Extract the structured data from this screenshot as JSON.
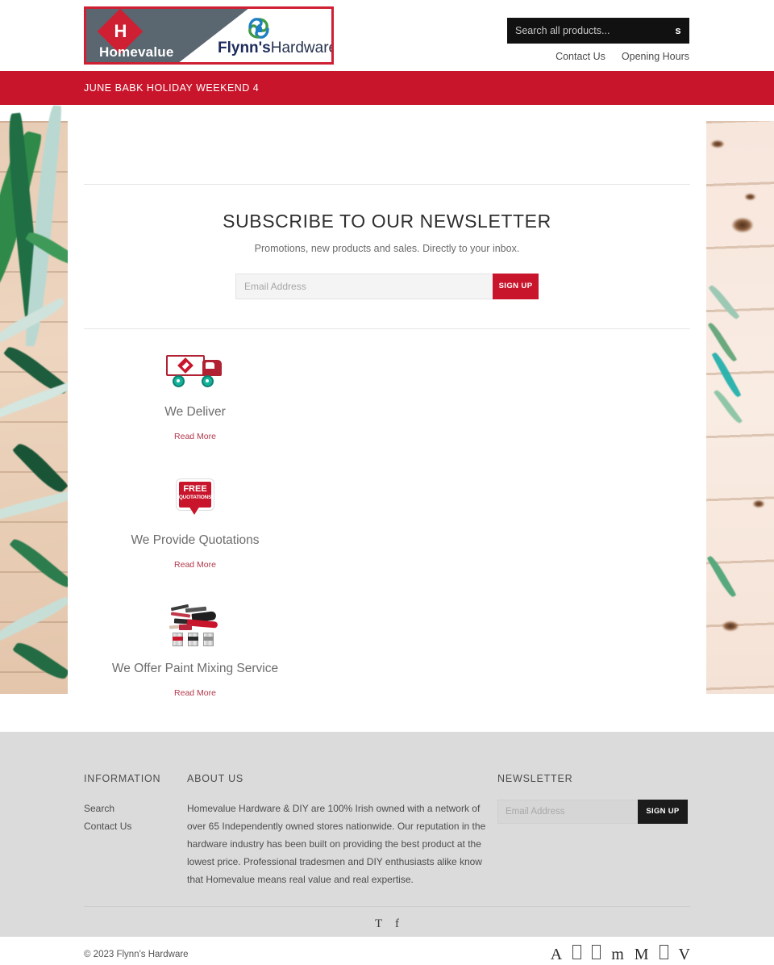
{
  "header": {
    "logo": {
      "homevalue": "Homevalue",
      "flynns": "Flynn's",
      "hardware": "Hardware"
    },
    "search": {
      "placeholder": "Search all products...",
      "value": "",
      "button_label": "s"
    },
    "links": [
      {
        "label": "Contact Us"
      },
      {
        "label": "Opening Hours"
      }
    ]
  },
  "announcement": {
    "text": "JUNE BABK HOLIDAY WEEKEND 4"
  },
  "newsletter": {
    "title": "SUBSCRIBE TO OUR NEWSLETTER",
    "subtitle": "Promotions, new products and sales. Directly to your inbox.",
    "email_placeholder": "Email Address",
    "email_value": "",
    "signup_label": "SIGN UP"
  },
  "features": [
    {
      "icon": "delivery-truck-icon",
      "title": "We Deliver",
      "link_label": "Read More"
    },
    {
      "icon": "free-quotations-badge-icon",
      "badge_line1": "FREE",
      "badge_line2": "QUOTATIONS",
      "title": "We Provide Quotations",
      "link_label": "Read More"
    },
    {
      "icon": "paint-mixing-icon",
      "title": "We Offer Paint Mixing Service",
      "link_label": "Read More"
    }
  ],
  "footer": {
    "information": {
      "heading": "INFORMATION",
      "links": [
        {
          "label": "Search"
        },
        {
          "label": "Contact Us"
        }
      ]
    },
    "about": {
      "heading": "ABOUT US",
      "body": "Homevalue Hardware & DIY are 100% Irish owned with a network of over 65 Independently owned stores nationwide. Our reputation in the hardware industry has been built on providing the best product at the lowest price. Professional tradesmen and DIY enthusiasts alike know that Homevalue means real value and real expertise."
    },
    "newsletter": {
      "heading": "NEWSLETTER",
      "email_placeholder": "Email Address",
      "email_value": "",
      "signup_label": "SIGN UP"
    },
    "social": [
      {
        "name": "twitter-icon",
        "glyph": "T"
      },
      {
        "name": "facebook-icon",
        "glyph": "f"
      }
    ],
    "copyright": "© 2023 Flynn's Hardware",
    "payment_icons": [
      {
        "name": "amex-icon",
        "glyph": "A"
      },
      {
        "name": "apple-pay-icon",
        "glyph": ""
      },
      {
        "name": "google-pay-icon",
        "glyph": ""
      },
      {
        "name": "maestro-icon",
        "glyph": "m"
      },
      {
        "name": "mastercard-icon",
        "glyph": "M"
      },
      {
        "name": "shop-pay-icon",
        "glyph": ""
      },
      {
        "name": "visa-icon",
        "glyph": "V"
      }
    ]
  },
  "colors": {
    "brand_red": "#c8152b",
    "logo_slate": "#5a6670",
    "footer_bg": "#dbdbdb",
    "link_red": "#b3384a",
    "search_bg": "#111111"
  }
}
